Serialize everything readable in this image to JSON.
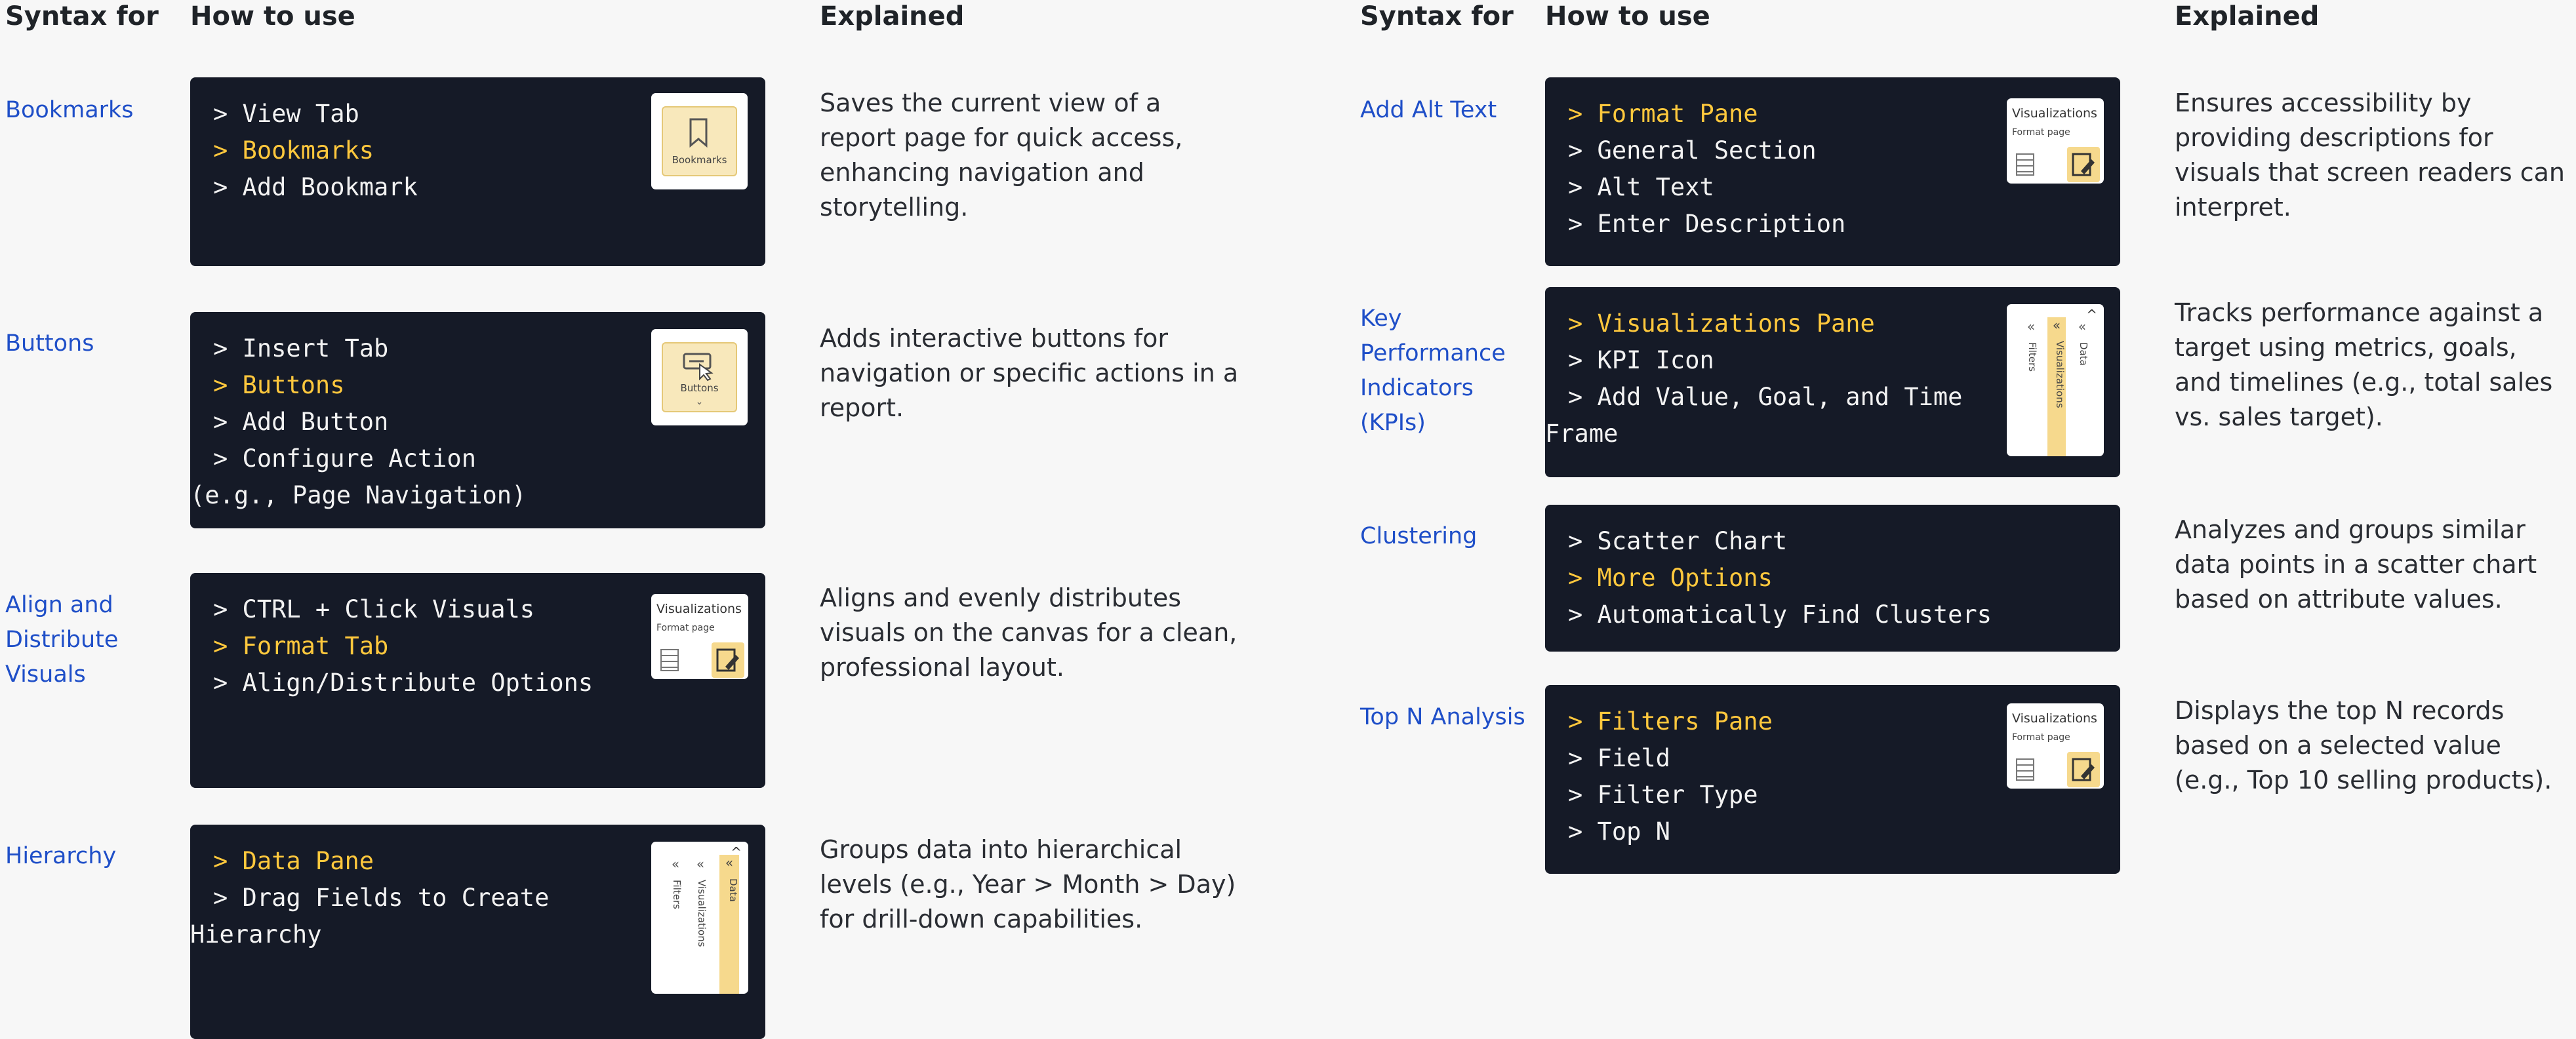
{
  "headers": {
    "syntax_for": "Syntax for",
    "how_to_use": "How to use",
    "explained": "Explained"
  },
  "left_rows": [
    {
      "syntax": "Bookmarks",
      "steps": [
        {
          "text": "> View Tab",
          "highlight": false
        },
        {
          "text": "> Bookmarks",
          "highlight": true
        },
        {
          "text": "> Add Bookmark",
          "highlight": false
        }
      ],
      "icon": "bookmark-icon",
      "icon_caption": "Bookmarks",
      "explained": "Saves the current view of a report page for quick access, enhancing navigation and storytelling."
    },
    {
      "syntax": "Buttons",
      "steps": [
        {
          "text": "> Insert Tab",
          "highlight": false
        },
        {
          "text": "> Buttons",
          "highlight": true
        },
        {
          "text": "> Add Button",
          "highlight": false
        },
        {
          "text": "> Configure Action",
          "highlight": false
        },
        {
          "text": "(e.g., Page Navigation)",
          "highlight": false
        }
      ],
      "icon": "buttons-icon",
      "icon_caption": "Buttons",
      "explained": "Adds interactive buttons for navigation or specific actions in a report."
    },
    {
      "syntax": "Align and Distribute Visuals",
      "steps": [
        {
          "text": "> CTRL + Click Visuals",
          "highlight": false
        },
        {
          "text": "> Format Tab",
          "highlight": true
        },
        {
          "text": "> Align/Distribute Options",
          "highlight": false
        }
      ],
      "icon": "format-visual-icon",
      "panel_title": "Visualizations",
      "panel_sub": "Format page",
      "explained": "Aligns and evenly distributes visuals on the canvas for a clean, professional layout."
    },
    {
      "syntax": "Hierarchy",
      "steps": [
        {
          "text": "> Data Pane",
          "highlight": true
        },
        {
          "text": "> Drag Fields to Create",
          "highlight": false
        },
        {
          "text": "Hierarchy",
          "highlight": false
        }
      ],
      "icon": "data-pane-icon",
      "pane_labels": {
        "filters": "Filters",
        "visualizations": "Visualizations",
        "data": "Data"
      },
      "explained": "Groups data into hierarchical levels (e.g., Year > Month > Day) for drill-down capabilities."
    }
  ],
  "right_rows": [
    {
      "syntax": "Add Alt Text",
      "steps": [
        {
          "text": "> Format Pane",
          "highlight": true
        },
        {
          "text": "> General Section",
          "highlight": false
        },
        {
          "text": "> Alt Text",
          "highlight": false
        },
        {
          "text": "> Enter Description",
          "highlight": false
        }
      ],
      "icon": "format-visual-icon",
      "panel_title": "Visualizations",
      "panel_sub": "Format page",
      "explained": "Ensures accessibility by providing descriptions for visuals that screen readers can interpret."
    },
    {
      "syntax": "Key Performance Indicators (KPIs)",
      "steps": [
        {
          "text": "> Visualizations Pane",
          "highlight": true
        },
        {
          "text": "> KPI Icon",
          "highlight": false
        },
        {
          "text": "> Add Value, Goal, and Time",
          "highlight": false
        },
        {
          "text": "Frame",
          "highlight": false
        }
      ],
      "icon": "visualizations-pane-icon",
      "pane_labels": {
        "filters": "Filters",
        "visualizations": "Visualizations",
        "data": "Data"
      },
      "explained": "Tracks performance against a target using metrics, goals, and timelines (e.g., total sales vs. sales target)."
    },
    {
      "syntax": "Clustering",
      "steps": [
        {
          "text": "> Scatter Chart",
          "highlight": false
        },
        {
          "text": "> More Options",
          "highlight": true
        },
        {
          "text": "> Automatically Find Clusters",
          "highlight": false
        }
      ],
      "explained": "Analyzes and groups similar data points in a scatter chart based on attribute values."
    },
    {
      "syntax": "Top N Analysis",
      "steps": [
        {
          "text": "> Filters Pane",
          "highlight": true
        },
        {
          "text": "> Field",
          "highlight": false
        },
        {
          "text": "> Filter Type",
          "highlight": false
        },
        {
          "text": "> Top N",
          "highlight": false
        }
      ],
      "icon": "format-visual-icon",
      "panel_title": "Visualizations",
      "panel_sub": "Format page",
      "explained": "Displays the top N records based on a selected value (e.g., Top 10 selling products)."
    }
  ]
}
